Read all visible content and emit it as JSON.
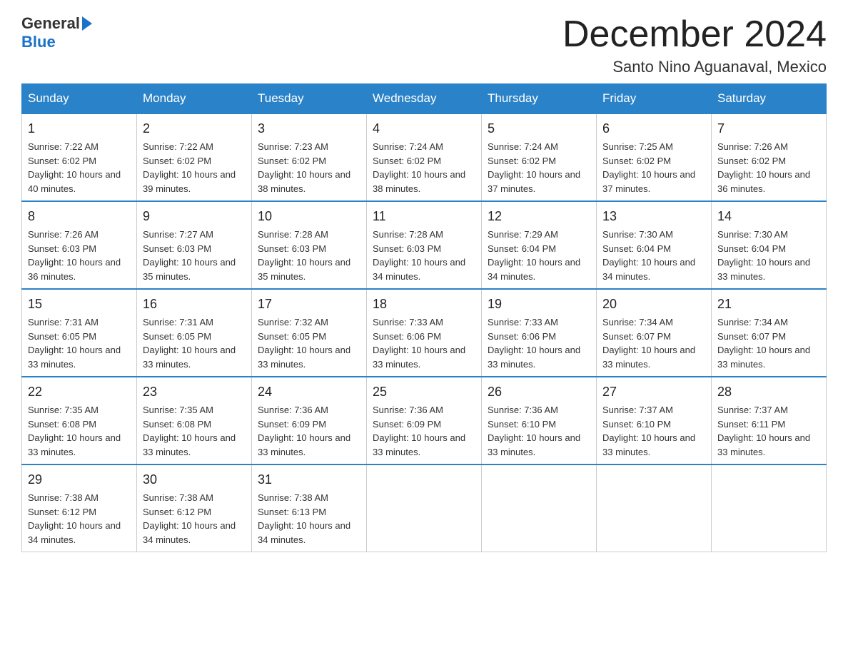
{
  "logo": {
    "part1": "General",
    "part2": "Blue"
  },
  "title": "December 2024",
  "subtitle": "Santo Nino Aguanaval, Mexico",
  "days_of_week": [
    "Sunday",
    "Monday",
    "Tuesday",
    "Wednesday",
    "Thursday",
    "Friday",
    "Saturday"
  ],
  "weeks": [
    [
      {
        "day": "1",
        "sunrise": "7:22 AM",
        "sunset": "6:02 PM",
        "daylight": "10 hours and 40 minutes."
      },
      {
        "day": "2",
        "sunrise": "7:22 AM",
        "sunset": "6:02 PM",
        "daylight": "10 hours and 39 minutes."
      },
      {
        "day": "3",
        "sunrise": "7:23 AM",
        "sunset": "6:02 PM",
        "daylight": "10 hours and 38 minutes."
      },
      {
        "day": "4",
        "sunrise": "7:24 AM",
        "sunset": "6:02 PM",
        "daylight": "10 hours and 38 minutes."
      },
      {
        "day": "5",
        "sunrise": "7:24 AM",
        "sunset": "6:02 PM",
        "daylight": "10 hours and 37 minutes."
      },
      {
        "day": "6",
        "sunrise": "7:25 AM",
        "sunset": "6:02 PM",
        "daylight": "10 hours and 37 minutes."
      },
      {
        "day": "7",
        "sunrise": "7:26 AM",
        "sunset": "6:02 PM",
        "daylight": "10 hours and 36 minutes."
      }
    ],
    [
      {
        "day": "8",
        "sunrise": "7:26 AM",
        "sunset": "6:03 PM",
        "daylight": "10 hours and 36 minutes."
      },
      {
        "day": "9",
        "sunrise": "7:27 AM",
        "sunset": "6:03 PM",
        "daylight": "10 hours and 35 minutes."
      },
      {
        "day": "10",
        "sunrise": "7:28 AM",
        "sunset": "6:03 PM",
        "daylight": "10 hours and 35 minutes."
      },
      {
        "day": "11",
        "sunrise": "7:28 AM",
        "sunset": "6:03 PM",
        "daylight": "10 hours and 34 minutes."
      },
      {
        "day": "12",
        "sunrise": "7:29 AM",
        "sunset": "6:04 PM",
        "daylight": "10 hours and 34 minutes."
      },
      {
        "day": "13",
        "sunrise": "7:30 AM",
        "sunset": "6:04 PM",
        "daylight": "10 hours and 34 minutes."
      },
      {
        "day": "14",
        "sunrise": "7:30 AM",
        "sunset": "6:04 PM",
        "daylight": "10 hours and 33 minutes."
      }
    ],
    [
      {
        "day": "15",
        "sunrise": "7:31 AM",
        "sunset": "6:05 PM",
        "daylight": "10 hours and 33 minutes."
      },
      {
        "day": "16",
        "sunrise": "7:31 AM",
        "sunset": "6:05 PM",
        "daylight": "10 hours and 33 minutes."
      },
      {
        "day": "17",
        "sunrise": "7:32 AM",
        "sunset": "6:05 PM",
        "daylight": "10 hours and 33 minutes."
      },
      {
        "day": "18",
        "sunrise": "7:33 AM",
        "sunset": "6:06 PM",
        "daylight": "10 hours and 33 minutes."
      },
      {
        "day": "19",
        "sunrise": "7:33 AM",
        "sunset": "6:06 PM",
        "daylight": "10 hours and 33 minutes."
      },
      {
        "day": "20",
        "sunrise": "7:34 AM",
        "sunset": "6:07 PM",
        "daylight": "10 hours and 33 minutes."
      },
      {
        "day": "21",
        "sunrise": "7:34 AM",
        "sunset": "6:07 PM",
        "daylight": "10 hours and 33 minutes."
      }
    ],
    [
      {
        "day": "22",
        "sunrise": "7:35 AM",
        "sunset": "6:08 PM",
        "daylight": "10 hours and 33 minutes."
      },
      {
        "day": "23",
        "sunrise": "7:35 AM",
        "sunset": "6:08 PM",
        "daylight": "10 hours and 33 minutes."
      },
      {
        "day": "24",
        "sunrise": "7:36 AM",
        "sunset": "6:09 PM",
        "daylight": "10 hours and 33 minutes."
      },
      {
        "day": "25",
        "sunrise": "7:36 AM",
        "sunset": "6:09 PM",
        "daylight": "10 hours and 33 minutes."
      },
      {
        "day": "26",
        "sunrise": "7:36 AM",
        "sunset": "6:10 PM",
        "daylight": "10 hours and 33 minutes."
      },
      {
        "day": "27",
        "sunrise": "7:37 AM",
        "sunset": "6:10 PM",
        "daylight": "10 hours and 33 minutes."
      },
      {
        "day": "28",
        "sunrise": "7:37 AM",
        "sunset": "6:11 PM",
        "daylight": "10 hours and 33 minutes."
      }
    ],
    [
      {
        "day": "29",
        "sunrise": "7:38 AM",
        "sunset": "6:12 PM",
        "daylight": "10 hours and 34 minutes."
      },
      {
        "day": "30",
        "sunrise": "7:38 AM",
        "sunset": "6:12 PM",
        "daylight": "10 hours and 34 minutes."
      },
      {
        "day": "31",
        "sunrise": "7:38 AM",
        "sunset": "6:13 PM",
        "daylight": "10 hours and 34 minutes."
      },
      null,
      null,
      null,
      null
    ]
  ]
}
